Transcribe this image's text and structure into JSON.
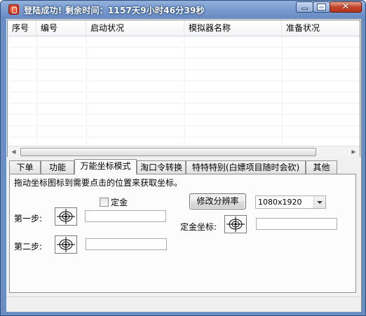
{
  "window": {
    "title": "登陆成功! 剩余时间：1157天9小时46分39秒",
    "close_glyph": "✕"
  },
  "listview": {
    "columns": [
      "序号",
      "编号",
      "启动状况",
      "模拟器名称",
      "准备状况"
    ],
    "rows": []
  },
  "tabs": [
    {
      "label": "下单",
      "active": false
    },
    {
      "label": "功能",
      "active": false
    },
    {
      "label": "万能坐标模式",
      "active": true
    },
    {
      "label": "淘口令转换",
      "active": false
    },
    {
      "label": "特特特别(白嫖项目随时会砍)",
      "active": false
    },
    {
      "label": "其他",
      "active": false
    }
  ],
  "panel": {
    "hint": "拖动坐标图标到需要点击的位置来获取坐标。",
    "fixed_gold_checkbox": {
      "label": "定金",
      "checked": false
    },
    "step1_label": "第一步:",
    "step2_label": "第二步:",
    "step1_value": "",
    "step2_value": "",
    "change_resolution_button": "修改分辨率",
    "resolution": {
      "selected": "1080x1920"
    },
    "fixed_gold_coord_label": "定金坐标:",
    "fixed_gold_coord_value": ""
  },
  "icons": {
    "crosshair": "crosshair-target-icon",
    "app": "app-logo-icon",
    "minimize": "minimize-icon",
    "maximize": "maximize-icon",
    "close": "close-icon"
  }
}
